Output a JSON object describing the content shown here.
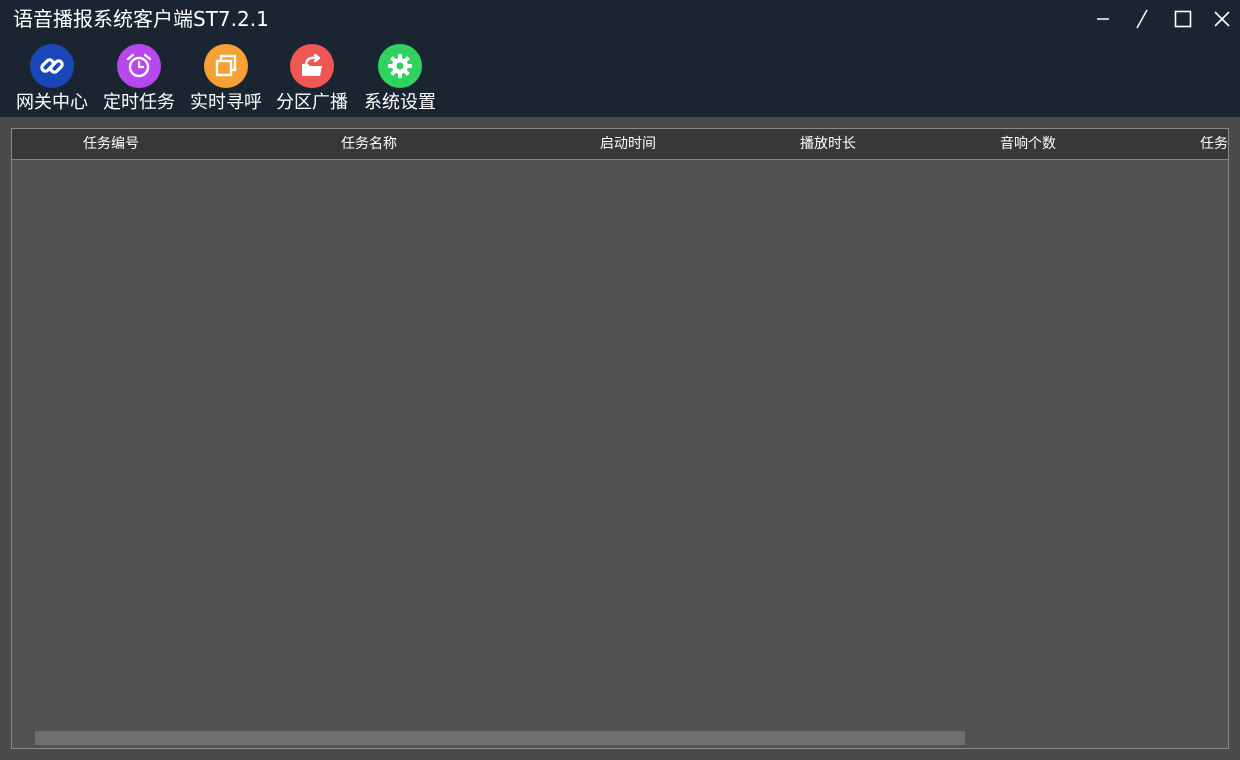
{
  "window": {
    "title": "语音播报系统客户端ST7.2.1",
    "controls": [
      "minimize-icon",
      "pin-icon",
      "maximize-icon",
      "close-icon"
    ]
  },
  "toolbar": {
    "items": [
      {
        "label": "网关中心",
        "icon": "link-icon",
        "color": "#1a47b8"
      },
      {
        "label": "定时任务",
        "icon": "alarm-clock-icon",
        "color": "#b548f0"
      },
      {
        "label": "实时寻呼",
        "icon": "windows-icon",
        "color": "#f7a033"
      },
      {
        "label": "分区广播",
        "icon": "folder-share-icon",
        "color": "#ee5754"
      },
      {
        "label": "系统设置",
        "icon": "gear-icon",
        "color": "#2fd35e"
      }
    ]
  },
  "table": {
    "columns": [
      "任务编号",
      "任务名称",
      "启动时间",
      "播放时长",
      "音响个数",
      "任务"
    ],
    "rows": []
  },
  "colors": {
    "titlebar": "#1b2431",
    "panel": "#515151",
    "header": "#383838",
    "accent": "#2b9fd9"
  }
}
